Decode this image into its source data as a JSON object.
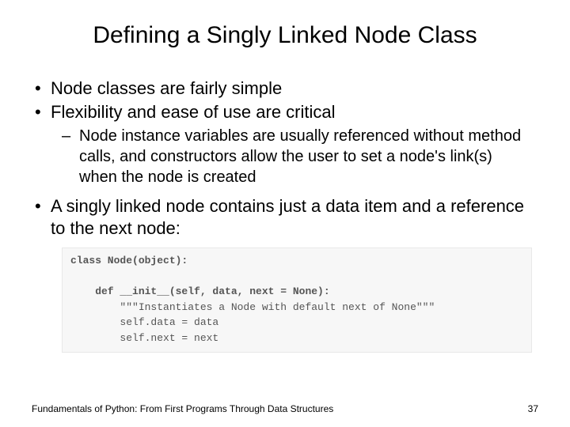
{
  "title": "Defining a Singly Linked Node Class",
  "bullets": {
    "b1": "Node classes are fairly simple",
    "b2": "Flexibility and ease of use are critical",
    "b2_sub": "Node instance variables are usually referenced without method calls, and constructors allow the user to set a node's link(s) when the node is created",
    "b3": "A singly linked node contains just a data item and a reference to the next node:"
  },
  "code": {
    "l1": "class Node(object):",
    "l2": "",
    "l3": "    def __init__(self, data, next = None):",
    "l4": "        \"\"\"Instantiates a Node with default next of None\"\"\"",
    "l5": "        self.data = data",
    "l6": "        self.next = next"
  },
  "footer": {
    "text": "Fundamentals of Python: From First Programs Through Data Structures",
    "page": "37"
  }
}
